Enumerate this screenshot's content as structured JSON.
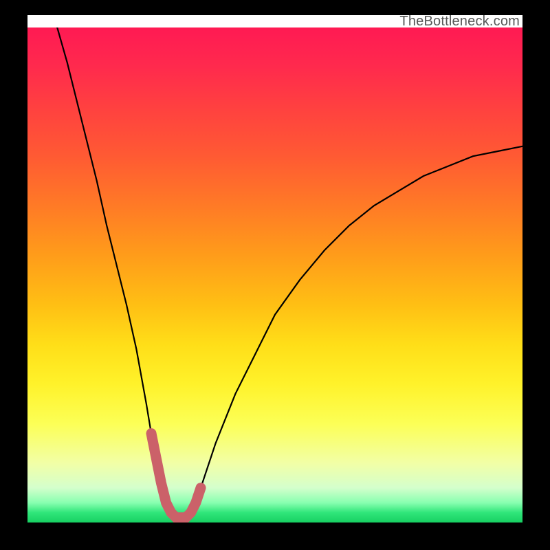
{
  "watermark": "TheBottleneck.com",
  "colors": {
    "frame_bg": "#000000",
    "watermark_text": "#565656",
    "curve_stroke": "#000000",
    "highlight_stroke": "#cb6169",
    "gradient_top": "#ff1a53",
    "gradient_bottom": "#17d062"
  },
  "chart_data": {
    "type": "line",
    "title": "",
    "xlabel": "",
    "ylabel": "",
    "xlim": [
      0,
      100
    ],
    "ylim": [
      0,
      100
    ],
    "grid": false,
    "legend": false,
    "annotations": [
      "TheBottleneck.com"
    ],
    "series": [
      {
        "name": "bottleneck-curve",
        "x": [
          6,
          8,
          10,
          12,
          14,
          16,
          18,
          20,
          22,
          24,
          25,
          26,
          27,
          28,
          29,
          30,
          31,
          32,
          33,
          34,
          35,
          36,
          38,
          42,
          46,
          50,
          55,
          60,
          65,
          70,
          75,
          80,
          85,
          90,
          95,
          100
        ],
        "y": [
          100,
          93,
          85,
          77,
          69,
          60,
          52,
          44,
          35,
          24,
          18,
          13,
          8,
          4,
          2,
          1,
          1,
          1,
          2,
          4,
          7,
          10,
          16,
          26,
          34,
          42,
          49,
          55,
          60,
          64,
          67,
          70,
          72,
          74,
          75,
          76
        ]
      },
      {
        "name": "optimal-zone-highlight",
        "x": [
          25,
          26,
          27,
          28,
          29,
          30,
          31,
          32,
          33,
          34,
          35
        ],
        "y": [
          18,
          13,
          8,
          4,
          2,
          1,
          1,
          1,
          2,
          4,
          7
        ]
      }
    ]
  }
}
